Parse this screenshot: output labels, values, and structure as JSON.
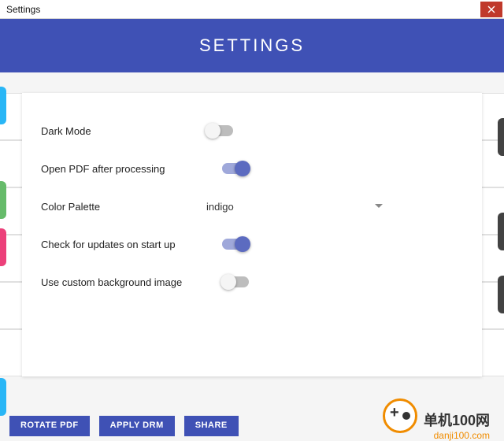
{
  "window": {
    "title": "Settings"
  },
  "header": {
    "title": "SETTINGS"
  },
  "options": {
    "dark_mode": {
      "label": "Dark Mode",
      "on": false
    },
    "open_pdf": {
      "label": "Open PDF after processing",
      "on": true
    },
    "color_palette": {
      "label": "Color Palette",
      "value": "indigo"
    },
    "check_updates": {
      "label": "Check for updates on start up",
      "on": true
    },
    "custom_bg": {
      "label": "Use custom background image",
      "on": false
    }
  },
  "background_buttons": [
    "ROTATE PDF",
    "APPLY DRM",
    "SHARE"
  ],
  "watermark": {
    "line1": "单机100网",
    "line2": "danji100.com"
  }
}
